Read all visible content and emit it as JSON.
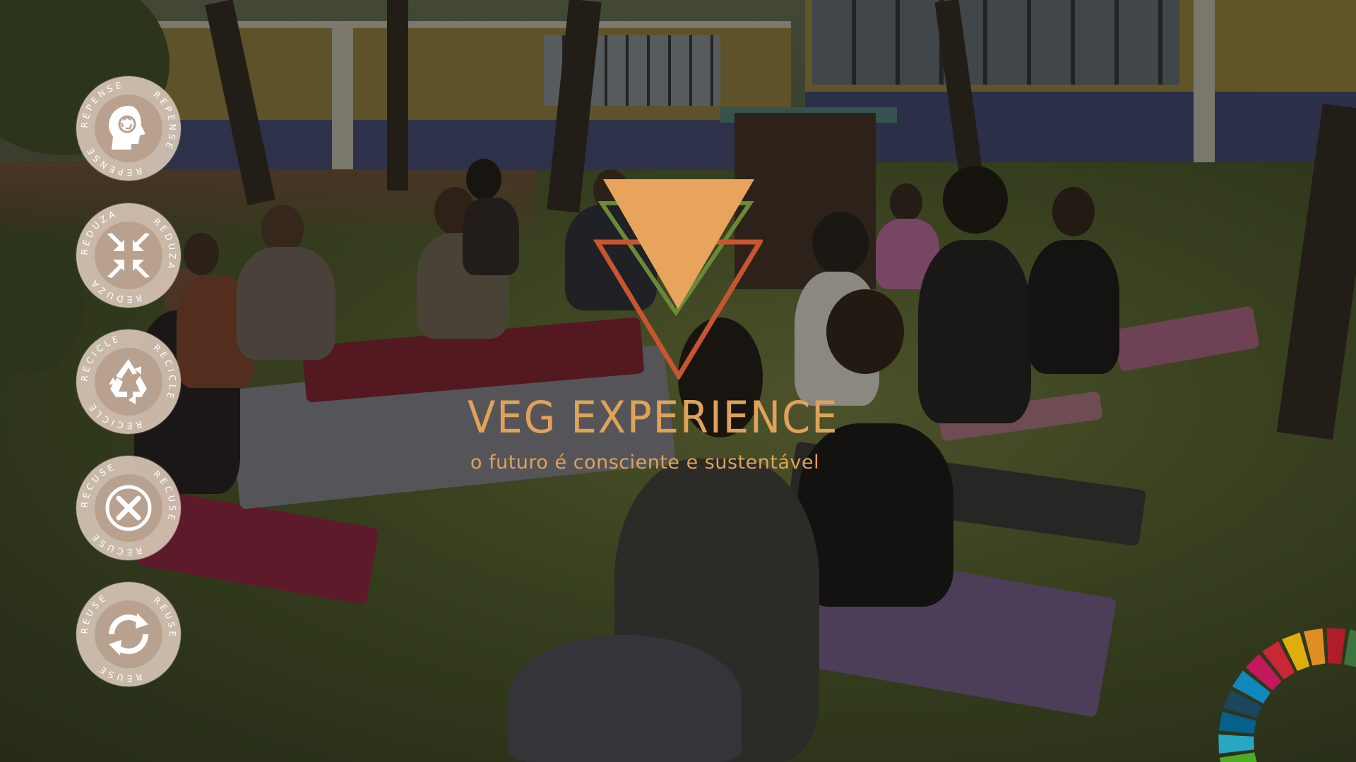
{
  "brand": {
    "title": "VEG EXPERIENCE",
    "tagline": "o futuro é consciente e sustentável",
    "accent_color": "#e0a258",
    "logo": {
      "triangles": [
        {
          "color": "#e8a45c",
          "style": "filled"
        },
        {
          "color": "#6a8a3a",
          "style": "outline"
        },
        {
          "color": "#c7552f",
          "style": "outline"
        }
      ]
    }
  },
  "r_badges": [
    {
      "label": "REPENSE",
      "icon": "head-recycle-icon"
    },
    {
      "label": "REDUZA",
      "icon": "compress-arrows-icon"
    },
    {
      "label": "RECICLE",
      "icon": "recycle-icon"
    },
    {
      "label": "RECUSE",
      "icon": "x-circle-icon"
    },
    {
      "label": "REUSE",
      "icon": "reuse-arrows-icon"
    }
  ],
  "sdg_wheel": {
    "icon": "sdg-color-wheel-icon",
    "colors": [
      "#4c9f38",
      "#56c02b",
      "#26bde2",
      "#00689d",
      "#19486a",
      "#0a97d9",
      "#dd1367",
      "#e5243b",
      "#fcc30b",
      "#fd9d24",
      "#c5192d",
      "#3f7e44",
      "#a21942",
      "#fd6925",
      "#bf8b2e",
      "#ff3a21",
      "#4c9f38"
    ]
  },
  "background": {
    "description_icon": "outdoor-meditation-photo"
  }
}
